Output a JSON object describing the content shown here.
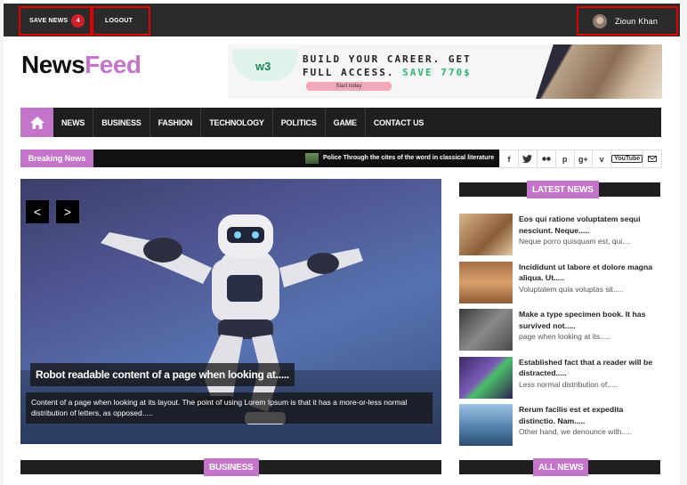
{
  "topbar": {
    "save_news_label": "SAVE NEWS",
    "save_news_count": "4",
    "logout_label": "LOGOUT",
    "user_name": "Zioun Khan"
  },
  "logo": {
    "part1": "News",
    "part2": "Feed"
  },
  "ad": {
    "brand": "w3",
    "line1": "BUILD YOUR CAREER. GET",
    "line2_a": "FULL ACCESS. ",
    "line2_b": "SAVE 770$",
    "cta": "Start today"
  },
  "nav": {
    "home_icon": "home-icon",
    "items": [
      "NEWS",
      "BUSINESS",
      "FASHION",
      "TECHNOLOGY",
      "POLITICS",
      "GAME",
      "CONTACT US"
    ]
  },
  "breaking": {
    "label": "Breaking News",
    "text": "Police Through the cites of the word in classical literature"
  },
  "social": [
    "f",
    "t",
    "flickr",
    "p",
    "g+",
    "v",
    "YouTube",
    "mail"
  ],
  "slider": {
    "prev": "<",
    "next": ">",
    "title": "Robot readable content of a page when looking at.....",
    "desc": "Content of a page when looking at its layout. The point of using Lorem Ipsum is that it has a more-or-less normal distribution of letters, as opposed....."
  },
  "latest": {
    "header": "LATEST NEWS",
    "items": [
      {
        "title": "Eos qui ratione voluptatem sequi nesciunt. Neque.....",
        "sub": "Neque porro quisquam est, qui....",
        "thumb": "#c79a6a"
      },
      {
        "title": "Incididunt ut labore et dolore magna aliqua. Ut.....",
        "sub": "Voluptatem quia voluptas sit.....",
        "thumb": "#b07a4a"
      },
      {
        "title": "Make a type specimen book. It has survived not.....",
        "sub": "page when looking at its.....",
        "thumb": "#5a5a5a"
      },
      {
        "title": "Established fact that a reader will be distracted.....",
        "sub": "Less normal distribution of.....",
        "thumb": "#5b3f8c"
      },
      {
        "title": "Rerum facilis est et expedita distinctio. Nam.....",
        "sub": "Other hand, we denounce with.....",
        "thumb": "#4f7aa5"
      }
    ]
  },
  "sections": {
    "business": "BUSINESS",
    "all_news": "ALL NEWS"
  }
}
